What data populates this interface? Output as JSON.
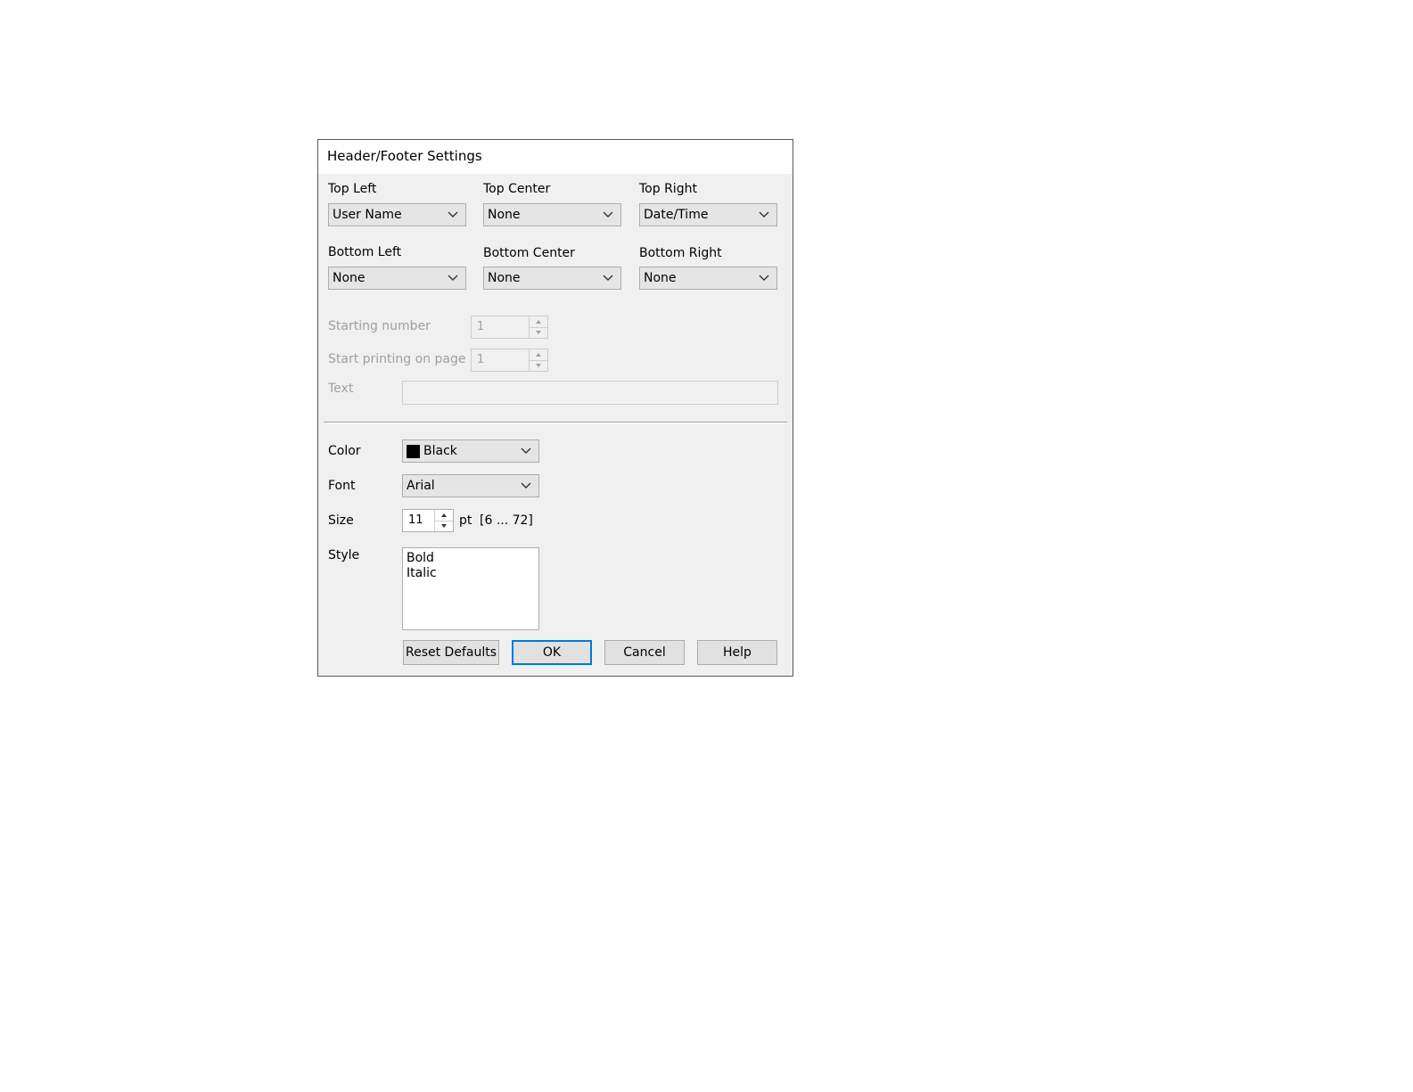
{
  "dialog": {
    "title": "Header/Footer Settings"
  },
  "positions": {
    "top_left": {
      "label": "Top Left",
      "value": "User Name"
    },
    "top_center": {
      "label": "Top Center",
      "value": "None"
    },
    "top_right": {
      "label": "Top Right",
      "value": "Date/Time"
    },
    "bottom_left": {
      "label": "Bottom Left",
      "value": "None"
    },
    "bottom_center": {
      "label": "Bottom Center",
      "value": "None"
    },
    "bottom_right": {
      "label": "Bottom Right",
      "value": "None"
    }
  },
  "numbering": {
    "starting_number_label": "Starting number",
    "starting_number_value": "1",
    "start_page_label": "Start printing on page",
    "start_page_value": "1",
    "text_label": "Text",
    "text_value": ""
  },
  "format": {
    "color_label": "Color",
    "color_value": "Black",
    "color_swatch": "#000000",
    "font_label": "Font",
    "font_value": "Arial",
    "size_label": "Size",
    "size_value": "11",
    "size_unit": "pt",
    "size_range": "[6 ... 72]",
    "style_label": "Style",
    "style_options": [
      "Bold",
      "Italic"
    ]
  },
  "buttons": {
    "reset": "Reset Defaults",
    "ok": "OK",
    "cancel": "Cancel",
    "help": "Help"
  },
  "colors": {
    "accent": "#0078d7",
    "dialog_bg": "#f0f0f0",
    "disabled_text": "#a0a0a0"
  }
}
